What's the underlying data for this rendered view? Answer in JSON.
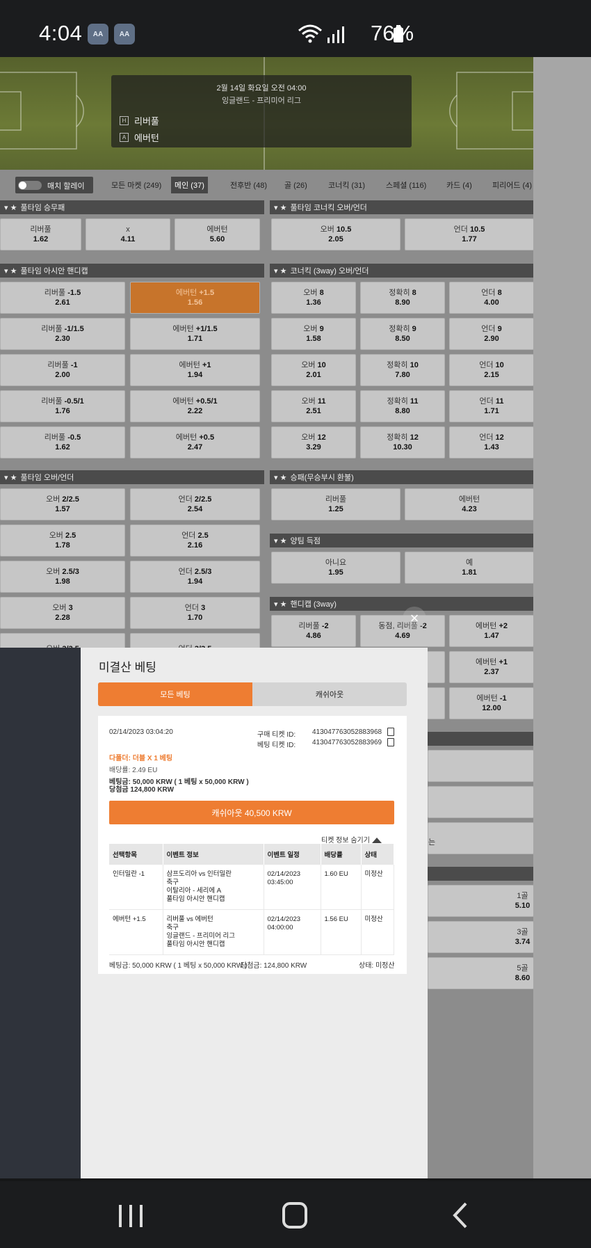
{
  "status": {
    "time": "4:04",
    "battery": "76%",
    "notif1": "AA",
    "notif2": "AA"
  },
  "match": {
    "date": "2월 14일 화요일 오전 04:00",
    "league": "잉글랜드 - 프리미어 리그",
    "home_badge": "H",
    "home": "리버풀",
    "away_badge": "A",
    "away": "에버턴"
  },
  "toggle_label": "매치 할레이",
  "tabs": [
    "모든 마켓 (249)",
    "메인 (37)",
    "전후반 (48)",
    "골 (26)",
    "코너킥 (31)",
    "스페셜 (116)",
    "카드 (4)",
    "피리어드 (4)"
  ],
  "sections": {
    "fulltime_1x2": {
      "title": "풀타임 승무패",
      "cells": [
        [
          "리버풀",
          "1.62"
        ],
        [
          "x",
          "4.11"
        ],
        [
          "에버턴",
          "5.60"
        ]
      ]
    },
    "corner_ou": {
      "title": "풀타임 코너킥 오버/언더",
      "cells": [
        [
          "오버",
          "10.5",
          "2.05"
        ],
        [
          "언더",
          "10.5",
          "1.77"
        ]
      ]
    },
    "asian_hcp": {
      "title": "풀타임 아시안 핸디캡",
      "rows": [
        [
          [
            "리버풀",
            "-1.5",
            "2.61"
          ],
          [
            "에버턴",
            "+1.5",
            "1.56"
          ]
        ],
        [
          [
            "리버풀",
            "-1/1.5",
            "2.30"
          ],
          [
            "에버턴",
            "+1/1.5",
            "1.71"
          ]
        ],
        [
          [
            "리버풀",
            "-1",
            "2.00"
          ],
          [
            "에버턴",
            "+1",
            "1.94"
          ]
        ],
        [
          [
            "리버풀",
            "-0.5/1",
            "1.76"
          ],
          [
            "에버턴",
            "+0.5/1",
            "2.22"
          ]
        ],
        [
          [
            "리버풀",
            "-0.5",
            "1.62"
          ],
          [
            "에버턴",
            "+0.5",
            "2.47"
          ]
        ]
      ]
    },
    "corner3way": {
      "title": "코너킥 (3way) 오버/언더",
      "rows": [
        [
          [
            "오버",
            "8",
            "1.36"
          ],
          [
            "정확히",
            "8",
            "8.90"
          ],
          [
            "언더",
            "8",
            "4.00"
          ]
        ],
        [
          [
            "오버",
            "9",
            "1.58"
          ],
          [
            "정확히",
            "9",
            "8.50"
          ],
          [
            "언더",
            "9",
            "2.90"
          ]
        ],
        [
          [
            "오버",
            "10",
            "2.01"
          ],
          [
            "정확히",
            "10",
            "7.80"
          ],
          [
            "언더",
            "10",
            "2.15"
          ]
        ],
        [
          [
            "오버",
            "11",
            "2.51"
          ],
          [
            "정확히",
            "11",
            "8.80"
          ],
          [
            "언더",
            "11",
            "1.71"
          ]
        ],
        [
          [
            "오버",
            "12",
            "3.29"
          ],
          [
            "정확히",
            "12",
            "10.30"
          ],
          [
            "언더",
            "12",
            "1.43"
          ]
        ]
      ]
    },
    "fulltime_ou": {
      "title": "풀타임 오버/언더",
      "rows": [
        [
          [
            "오버",
            "2/2.5",
            "1.57"
          ],
          [
            "언더",
            "2/2.5",
            "2.54"
          ]
        ],
        [
          [
            "오버",
            "2.5",
            "1.78"
          ],
          [
            "언더",
            "2.5",
            "2.16"
          ]
        ],
        [
          [
            "오버",
            "2.5/3",
            "1.98"
          ],
          [
            "언더",
            "2.5/3",
            "1.94"
          ]
        ],
        [
          [
            "오버",
            "3",
            "2.28"
          ],
          [
            "언더",
            "3",
            "1.70"
          ]
        ],
        [
          [
            "오버",
            "3/3.5",
            ""
          ],
          [
            "언더",
            "3/3.5",
            ""
          ]
        ]
      ]
    },
    "dnb": {
      "title": "승패(무승부시 환불)",
      "cells": [
        [
          "리버풀",
          "1.25"
        ],
        [
          "에버턴",
          "4.23"
        ]
      ]
    },
    "btts": {
      "title": "양팀 득점",
      "cells": [
        [
          "아니요",
          "1.95"
        ],
        [
          "예",
          "1.81"
        ]
      ]
    },
    "hcp3way": {
      "title": "핸디캡 (3way)",
      "rows": [
        [
          [
            "리버풀",
            "-2",
            "4.86"
          ],
          [
            "동점, 리버풀",
            "-2",
            "4.69"
          ],
          [
            "에버턴",
            "+2",
            "1.47"
          ]
        ],
        [
          [
            "",
            "",
            ""
          ],
          [
            "",
            "",
            ""
          ],
          [
            "에버턴",
            "+1",
            "2.37"
          ]
        ],
        [
          [
            "",
            "",
            ""
          ],
          [
            "",
            "",
            ""
          ],
          [
            "에버턴",
            "-1",
            "12.00"
          ]
        ]
      ]
    },
    "goals_partial": [
      [
        "1골",
        "5.10"
      ],
      [
        "3골",
        "3.74"
      ],
      [
        "5골",
        "8.60"
      ]
    ],
    "partial_char": "는"
  },
  "modal": {
    "title": "미결산 베팅",
    "tab_all": "모든 베팅",
    "tab_cashout": "캐쉬아웃",
    "date": "02/14/2023 03:04:20",
    "purchase_label": "구매 티켓 ID:",
    "purchase_id": "413047763052883968",
    "bet_label": "베팅 티켓 ID:",
    "bet_id": "413047763052883969",
    "bet_type": "다폴더: 더블 X 1 베팅",
    "odds_line": "배당률: 2.49 EU",
    "stake_line": "베팅금: 50,000 KRW ( 1 베팅 x 50,000 KRW )",
    "win_line": "당첨금 124,800 KRW",
    "cashout_btn": "캐쉬아웃 40,500 KRW",
    "hide_info": "티켓 정보 숨기기",
    "headers": [
      "선택항목",
      "이벤트 정보",
      "이벤트 일정",
      "배당률",
      "상태"
    ],
    "rows": [
      {
        "sel": "인터밀란 -1",
        "ev1": "삼프도리아 vs 인터밀란",
        "ev2": "축구",
        "ev3": "이탈리아 - 세리에 A",
        "ev4": "풀타임 아시안 핸디캡",
        "date": "02/14/2023",
        "time": "03:45:00",
        "odds": "1.60 EU",
        "status": "미정산"
      },
      {
        "sel": "에버턴 +1.5",
        "ev1": "리버풀 vs 에버턴",
        "ev2": "축구",
        "ev3": "잉글랜드 - 프리미어 리그",
        "ev4": "풀타임 아시안 핸디캡",
        "date": "02/14/2023",
        "time": "04:00:00",
        "odds": "1.56 EU",
        "status": "미정산"
      }
    ],
    "footer_stake": "베팅금: 50,000 KRW ( 1 베팅 x 50,000 KRW )",
    "footer_win": "당첨금: 124,800 KRW",
    "footer_status": "상태: 미정산"
  }
}
